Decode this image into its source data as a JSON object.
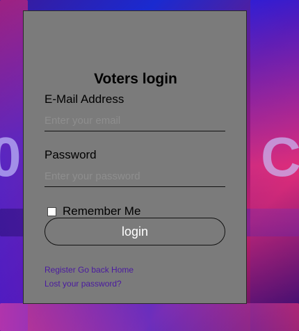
{
  "form": {
    "title": "Voters login",
    "email_label": "E-Mail Address",
    "email_placeholder": "Enter your email",
    "password_label": "Password",
    "password_placeholder": "Enter your password",
    "remember_label": "Remember Me",
    "login_label": "login"
  },
  "links": {
    "register": "Register",
    "home": "Go back Home",
    "lost_password": "Lost your password?"
  },
  "colors": {
    "card_bg": "#7b7b7b",
    "link": "#4a1aa0"
  }
}
